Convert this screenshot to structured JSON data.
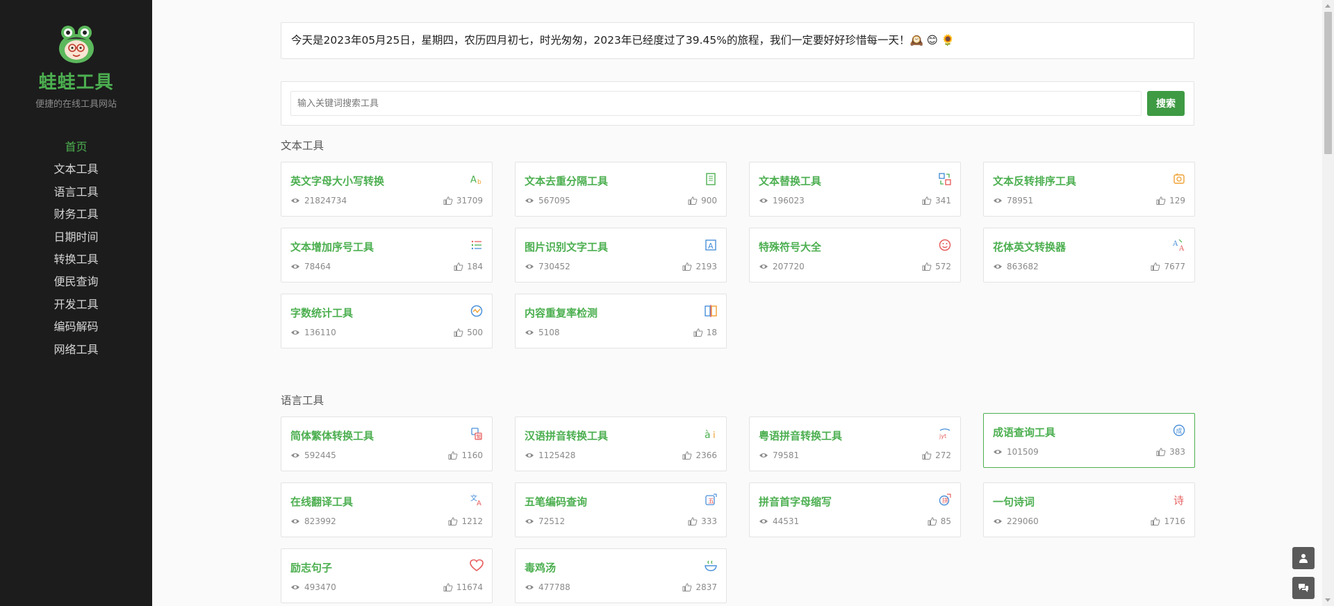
{
  "brand": {
    "name": "蛙蛙工具",
    "slogan": "便捷的在线工具网站"
  },
  "nav": [
    {
      "label": "首页",
      "active": true
    },
    {
      "label": "文本工具"
    },
    {
      "label": "语言工具"
    },
    {
      "label": "财务工具"
    },
    {
      "label": "日期时间"
    },
    {
      "label": "转换工具"
    },
    {
      "label": "便民查询"
    },
    {
      "label": "开发工具"
    },
    {
      "label": "编码解码"
    },
    {
      "label": "网络工具"
    }
  ],
  "notice": "今天是2023年05月25日，星期四，农历四月初七，时光匆匆，2023年已经度过了39.45%的旅程，我们一定要好好珍惜每一天！🕰️ 😊 🌻",
  "search": {
    "placeholder": "输入关键词搜索工具",
    "button": "搜索"
  },
  "sections": [
    {
      "title": "文本工具",
      "tools": [
        {
          "name": "英文字母大小写转换",
          "views": "21824734",
          "likes": "31709",
          "icon": "letter-case-icon"
        },
        {
          "name": "文本去重分隔工具",
          "views": "567095",
          "likes": "900",
          "icon": "document-icon"
        },
        {
          "name": "文本替换工具",
          "views": "196023",
          "likes": "341",
          "icon": "replace-icon"
        },
        {
          "name": "文本反转排序工具",
          "views": "78951",
          "likes": "129",
          "icon": "reverse-icon"
        },
        {
          "name": "文本增加序号工具",
          "views": "78464",
          "likes": "184",
          "icon": "list-icon"
        },
        {
          "name": "图片识别文字工具",
          "views": "730452",
          "likes": "2193",
          "icon": "ocr-icon"
        },
        {
          "name": "特殊符号大全",
          "views": "207720",
          "likes": "572",
          "icon": "smiley-icon"
        },
        {
          "name": "花体英文转换器",
          "views": "863682",
          "likes": "7677",
          "icon": "fancy-font-icon"
        },
        {
          "name": "字数统计工具",
          "views": "136110",
          "likes": "500",
          "icon": "count-icon"
        },
        {
          "name": "内容重复率检测",
          "views": "5108",
          "likes": "18",
          "icon": "compare-icon"
        }
      ]
    },
    {
      "title": "语言工具",
      "tools": [
        {
          "name": "简体繁体转换工具",
          "views": "592445",
          "likes": "1160",
          "icon": "simplified-traditional-icon"
        },
        {
          "name": "汉语拼音转换工具",
          "views": "1125428",
          "likes": "2366",
          "icon": "pinyin-icon"
        },
        {
          "name": "粤语拼音转换工具",
          "views": "79581",
          "likes": "272",
          "icon": "cantonese-icon"
        },
        {
          "name": "成语查询工具",
          "views": "101509",
          "likes": "383",
          "icon": "idiom-icon",
          "highlight": true
        },
        {
          "name": "在线翻译工具",
          "views": "823992",
          "likes": "1212",
          "icon": "translate-icon"
        },
        {
          "name": "五笔编码查询",
          "views": "72512",
          "likes": "333",
          "icon": "wubi-icon"
        },
        {
          "name": "拼音首字母缩写",
          "views": "44531",
          "likes": "85",
          "icon": "initials-icon"
        },
        {
          "name": "一句诗词",
          "views": "229060",
          "likes": "1716",
          "icon": "poem-icon",
          "glyph": "诗"
        },
        {
          "name": "励志句子",
          "views": "493470",
          "likes": "11674",
          "icon": "heart-icon"
        },
        {
          "name": "毒鸡汤",
          "views": "477788",
          "likes": "2837",
          "icon": "soup-icon"
        }
      ]
    }
  ],
  "colors": {
    "accent": "#4caf50",
    "sidebar": "#1c1c1c",
    "button": "#3e9a43"
  }
}
